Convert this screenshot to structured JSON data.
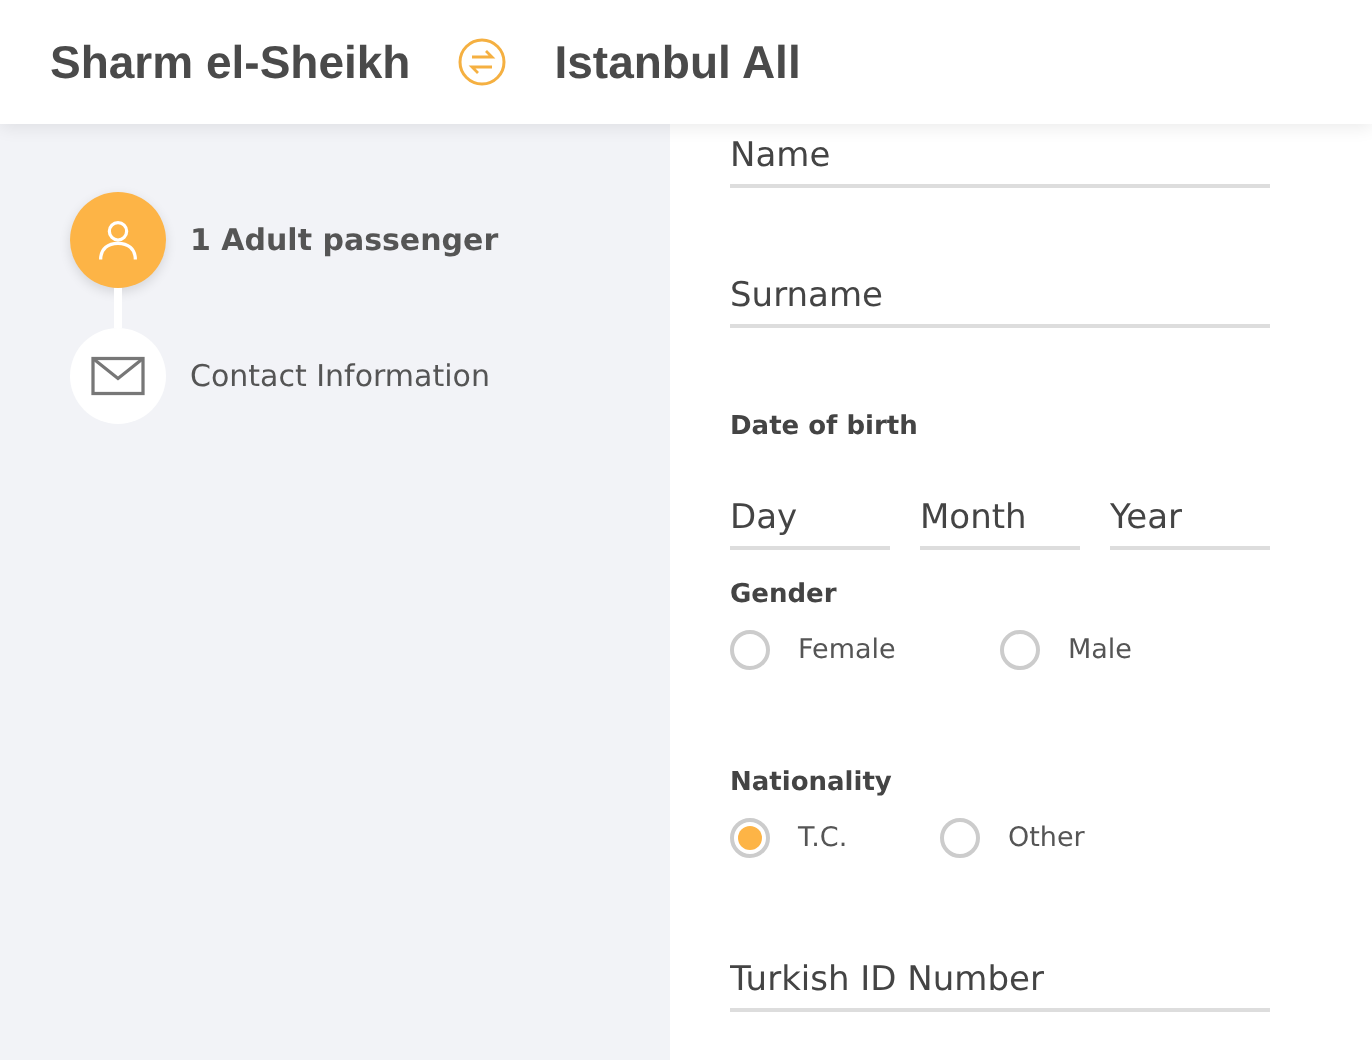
{
  "header": {
    "origin": "Sharm el-Sheikh",
    "destination": "Istanbul All"
  },
  "steps": [
    {
      "kind": "person",
      "label": "1 Adult passenger",
      "selected": true
    },
    {
      "kind": "mail",
      "label": "Contact Information",
      "selected": false
    }
  ],
  "form": [
    {
      "kind": "field",
      "placeholder": "Name"
    },
    {
      "kind": "field",
      "placeholder": "Surname"
    },
    {
      "kind": "heading",
      "text": "Date of birth"
    },
    {
      "kind": "fields",
      "items": [
        {
          "placeholder": "Day"
        },
        {
          "placeholder": "Month"
        },
        {
          "placeholder": "Year"
        }
      ]
    },
    {
      "kind": "heading",
      "text": "Gender"
    },
    {
      "kind": "radios",
      "options": [
        {
          "label": "Female",
          "selected": false
        },
        {
          "label": "Male",
          "selected": false
        }
      ]
    },
    {
      "kind": "heading",
      "text": "Nationality"
    },
    {
      "kind": "radios",
      "options": [
        {
          "label": "T.C.",
          "selected": true
        },
        {
          "label": "Other",
          "selected": false
        }
      ]
    },
    {
      "kind": "field",
      "placeholder": "Turkish ID Number"
    }
  ]
}
